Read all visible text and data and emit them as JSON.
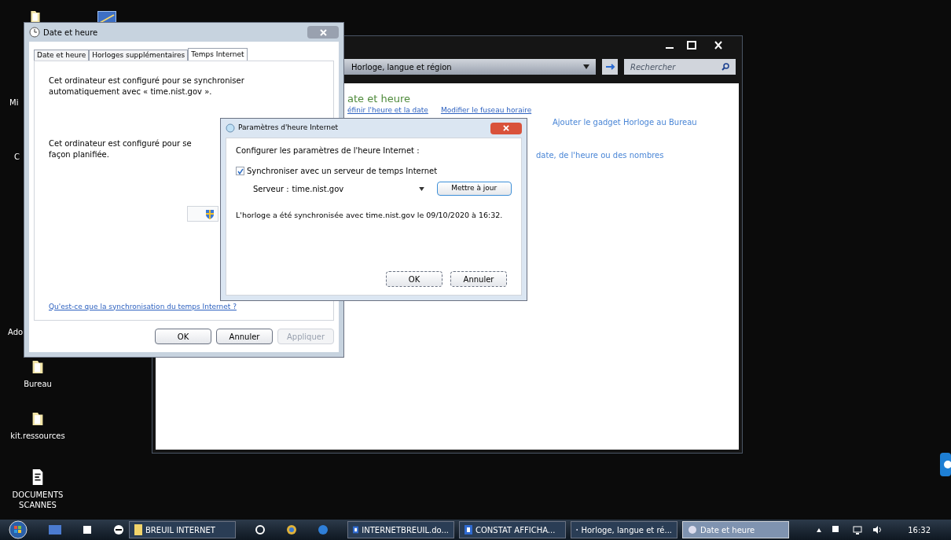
{
  "desktop_icons": [
    {
      "label": "Mi",
      "kind": "cut"
    },
    {
      "label": "C",
      "kind": "cut"
    },
    {
      "label": "Ado",
      "kind": "cut"
    },
    {
      "label": "Bureau",
      "kind": "folder"
    },
    {
      "label": "kit.ressources",
      "kind": "folder"
    },
    {
      "label": "DOCUMENTS SCANNES",
      "kind": "document"
    }
  ],
  "control_panel": {
    "address": "Horloge, langue et région",
    "search": {
      "placeholder": "Rechercher"
    },
    "heading": "ate et heure",
    "task_links": [
      "éfinir l'heure et la date",
      "Modifier le fuseau horaire"
    ],
    "gadget_link": "Ajouter le gadget Horloge au Bureau",
    "format_link": "date, de l'heure ou des nombres"
  },
  "date_dialog": {
    "title": "Date et heure",
    "tabs": [
      {
        "label": "Date et heure",
        "selected": false
      },
      {
        "label": "Horloges supplémentaires",
        "selected": false
      },
      {
        "label": "Temps Internet",
        "selected": true
      }
    ],
    "text_1": "Cet ordinateur est configuré pour se synchroniser automatiquement avec « time.nist.gov ».",
    "text_2a": "Cet ordinateur est configuré pour se",
    "text_2b": "façon planifiée.",
    "link": "Qu'est-ce que la synchronisation du temps Internet ?",
    "buttons": [
      {
        "label": "OK",
        "disabled": false
      },
      {
        "label": "Annuler",
        "disabled": false
      },
      {
        "label": "Appliquer",
        "disabled": true
      }
    ]
  },
  "internet_dialog": {
    "title": "Paramètres d'heure Internet",
    "intro": "Configurer les paramètres de l'heure Internet :",
    "checkbox": {
      "label": "Synchroniser avec un serveur de temps Internet",
      "checked": true
    },
    "server_label": "Serveur :",
    "server": "time.nist.gov",
    "update_button": "Mettre à jour",
    "status": "L'horloge a été synchronisée avec time.nist.gov le 09/10/2020 à 16:32.",
    "buttons": [
      {
        "label": "OK"
      },
      {
        "label": "Annuler"
      }
    ]
  },
  "taskbar": {
    "items": [
      {
        "label": "BREUIL INTERNET",
        "kind": "folder",
        "selected": false
      },
      {
        "label": "INTERNETBREUIL.do...",
        "kind": "doc",
        "selected": false
      },
      {
        "label": "CONSTAT AFFICHA...",
        "kind": "doc",
        "selected": false
      },
      {
        "label": "Horloge, langue et ré...",
        "kind": "panel",
        "selected": false
      },
      {
        "label": "Date et heure",
        "kind": "panel",
        "selected": true
      }
    ],
    "clock": "16:32"
  }
}
